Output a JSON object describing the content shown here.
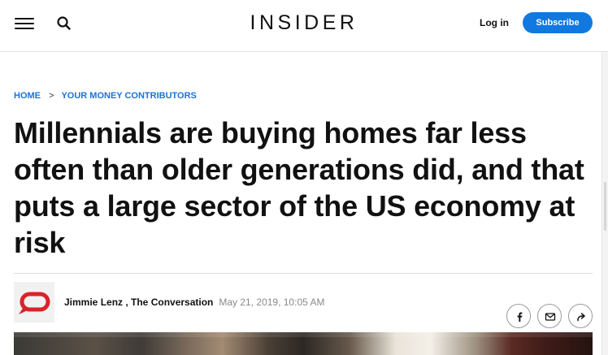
{
  "header": {
    "logo": "INSIDER",
    "login_label": "Log in",
    "subscribe_label": "Subscribe",
    "icons": {
      "menu": "hamburger-menu-icon",
      "search": "search-icon"
    },
    "accent_color": "#1178e0"
  },
  "breadcrumb": {
    "home": "HOME",
    "separator": ">",
    "section": "YOUR MONEY CONTRIBUTORS"
  },
  "article": {
    "headline": "Millennials are buying homes far less often than older generations did, and that puts a large sector of the US economy at risk",
    "author": "Jimmie Lenz , The Conversation",
    "timestamp": "May 21, 2019, 10:05 AM",
    "source_logo_icon": "the-conversation-logo-icon"
  },
  "share": {
    "icons": [
      "facebook-icon",
      "email-icon",
      "forward-share-icon"
    ]
  }
}
